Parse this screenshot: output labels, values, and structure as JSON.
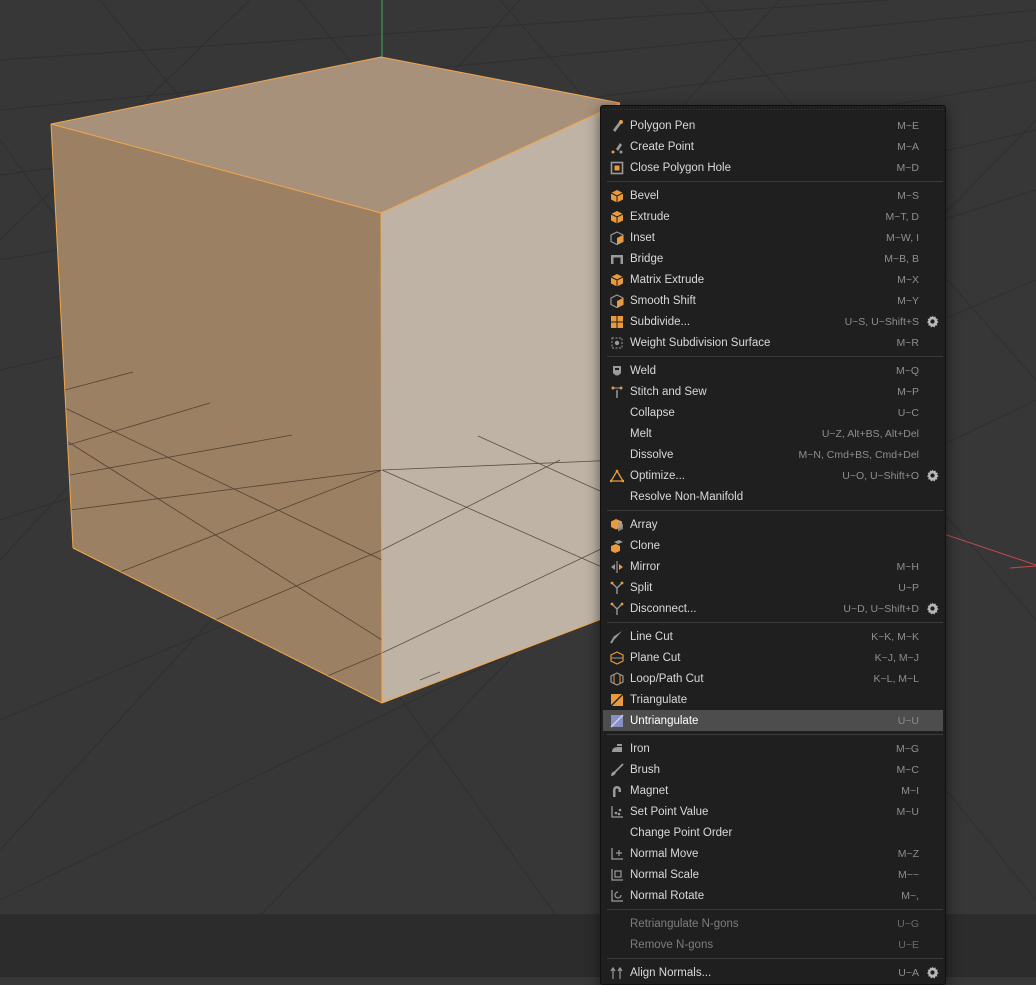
{
  "colors": {
    "viewport_bg": "#373737",
    "menu_bg": "#1f1f1f",
    "highlight_bg": "#4d4d4d",
    "icon_orange": "#e89a3c",
    "icon_gray": "#9a9a9a",
    "selection_edge": "#f4a64a",
    "cube_top": "#a8917b",
    "cube_left": "#9b8063",
    "cube_right": "#bfb3a6"
  },
  "menu": {
    "sections": [
      [
        {
          "name": "polygon-pen",
          "label": "Polygon Pen",
          "shortcut": "M~E",
          "icon": "pen-icon"
        },
        {
          "name": "create-point",
          "label": "Create Point",
          "shortcut": "M~A",
          "icon": "pen-point-icon"
        },
        {
          "name": "close-polygon-hole",
          "label": "Close Polygon Hole",
          "shortcut": "M~D",
          "icon": "close-hole-icon"
        }
      ],
      [
        {
          "name": "bevel",
          "label": "Bevel",
          "shortcut": "M~S",
          "icon": "cube-icon"
        },
        {
          "name": "extrude",
          "label": "Extrude",
          "shortcut": "M~T, D",
          "icon": "cube-icon"
        },
        {
          "name": "inset",
          "label": "Inset",
          "shortcut": "M~W, I",
          "icon": "cube-outline-icon"
        },
        {
          "name": "bridge",
          "label": "Bridge",
          "shortcut": "M~B, B",
          "icon": "bridge-icon"
        },
        {
          "name": "matrix-extrude",
          "label": "Matrix Extrude",
          "shortcut": "M~X",
          "icon": "cube-icon"
        },
        {
          "name": "smooth-shift",
          "label": "Smooth Shift",
          "shortcut": "M~Y",
          "icon": "cube-outline-icon"
        },
        {
          "name": "subdivide",
          "label": "Subdivide...",
          "shortcut": "U~S, U~Shift+S",
          "icon": "grid-icon",
          "settings": true
        },
        {
          "name": "weight-subdivision-surface",
          "label": "Weight Subdivision Surface",
          "shortcut": "M~R",
          "icon": "weight-icon"
        }
      ],
      [
        {
          "name": "weld",
          "label": "Weld",
          "shortcut": "M~Q",
          "icon": "weld-icon"
        },
        {
          "name": "stitch-and-sew",
          "label": "Stitch and Sew",
          "shortcut": "M~P",
          "icon": "stitch-icon"
        },
        {
          "name": "collapse",
          "label": "Collapse",
          "shortcut": "U~C",
          "icon": ""
        },
        {
          "name": "melt",
          "label": "Melt",
          "shortcut": "U~Z, Alt+BS, Alt+Del",
          "icon": ""
        },
        {
          "name": "dissolve",
          "label": "Dissolve",
          "shortcut": "M~N, Cmd+BS, Cmd+Del",
          "icon": ""
        },
        {
          "name": "optimize",
          "label": "Optimize...",
          "shortcut": "U~O, U~Shift+O",
          "icon": "optimize-icon",
          "settings": true
        },
        {
          "name": "resolve-non-manifold",
          "label": "Resolve Non-Manifold",
          "shortcut": "",
          "icon": ""
        }
      ],
      [
        {
          "name": "array",
          "label": "Array",
          "shortcut": "",
          "icon": "array-icon"
        },
        {
          "name": "clone",
          "label": "Clone",
          "shortcut": "",
          "icon": "clone-icon"
        },
        {
          "name": "mirror",
          "label": "Mirror",
          "shortcut": "M~H",
          "icon": "mirror-icon"
        },
        {
          "name": "split",
          "label": "Split",
          "shortcut": "U~P",
          "icon": "split-icon"
        },
        {
          "name": "disconnect",
          "label": "Disconnect...",
          "shortcut": "U~D, U~Shift+D",
          "icon": "split-icon",
          "settings": true
        }
      ],
      [
        {
          "name": "line-cut",
          "label": "Line Cut",
          "shortcut": "K~K, M~K",
          "icon": "knife-icon"
        },
        {
          "name": "plane-cut",
          "label": "Plane Cut",
          "shortcut": "K~J, M~J",
          "icon": "plane-cut-icon"
        },
        {
          "name": "loop-path-cut",
          "label": "Loop/Path Cut",
          "shortcut": "K~L, M~L",
          "icon": "loop-cut-icon"
        },
        {
          "name": "triangulate",
          "label": "Triangulate",
          "shortcut": "",
          "icon": "triangulate-icon"
        },
        {
          "name": "untriangulate",
          "label": "Untriangulate",
          "shortcut": "U~U",
          "icon": "untriangulate-icon",
          "highlighted": true
        }
      ],
      [
        {
          "name": "iron",
          "label": "Iron",
          "shortcut": "M~G",
          "icon": "iron-icon"
        },
        {
          "name": "brush",
          "label": "Brush",
          "shortcut": "M~C",
          "icon": "brush-icon"
        },
        {
          "name": "magnet",
          "label": "Magnet",
          "shortcut": "M~I",
          "icon": "magnet-icon"
        },
        {
          "name": "set-point-value",
          "label": "Set Point Value",
          "shortcut": "M~U",
          "icon": "point-value-icon"
        },
        {
          "name": "change-point-order",
          "label": "Change Point Order",
          "shortcut": "",
          "icon": ""
        },
        {
          "name": "normal-move",
          "label": "Normal Move",
          "shortcut": "M~Z",
          "icon": "normal-move-icon"
        },
        {
          "name": "normal-scale",
          "label": "Normal Scale",
          "shortcut": "M~~",
          "icon": "normal-scale-icon"
        },
        {
          "name": "normal-rotate",
          "label": "Normal Rotate",
          "shortcut": "M~,",
          "icon": "normal-rotate-icon"
        }
      ],
      [
        {
          "name": "retriangulate-ngons",
          "label": "Retriangulate N-gons",
          "shortcut": "U~G",
          "icon": "",
          "disabled": true
        },
        {
          "name": "remove-ngons",
          "label": "Remove N-gons",
          "shortcut": "U~E",
          "icon": "",
          "disabled": true
        }
      ],
      [
        {
          "name": "align-normals",
          "label": "Align Normals...",
          "shortcut": "U~A",
          "icon": "align-normals-icon",
          "settings": true
        }
      ]
    ]
  }
}
